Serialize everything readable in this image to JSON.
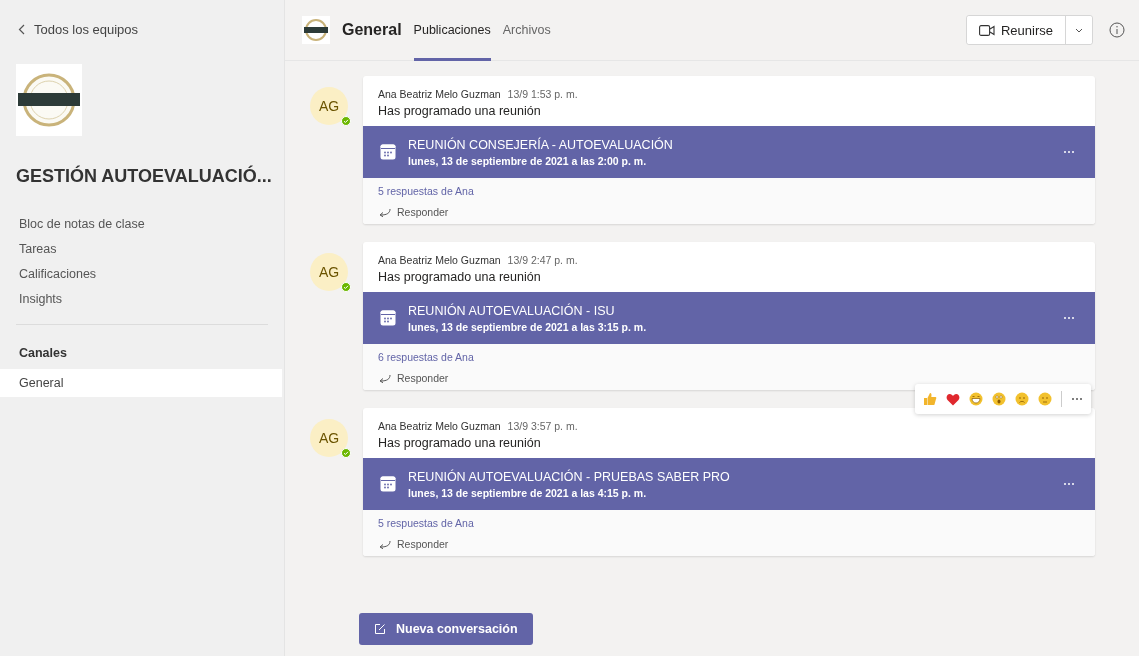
{
  "sidebar": {
    "back_link": "Todos los equipos",
    "team_name": "GESTIÓN AUTOEVALUACIÓ...",
    "items": [
      {
        "label": "Bloc de notas de clase"
      },
      {
        "label": "Tareas"
      },
      {
        "label": "Calificaciones"
      },
      {
        "label": "Insights"
      }
    ],
    "channels_heading": "Canales",
    "channels": [
      {
        "label": "General",
        "selected": true
      }
    ]
  },
  "header": {
    "channel": "General",
    "tabs": [
      {
        "label": "Publicaciones",
        "selected": true
      },
      {
        "label": "Archivos",
        "selected": false
      }
    ],
    "meet_button": "Reunirse"
  },
  "messages": [
    {
      "avatar": "AG",
      "author": "Ana Beatriz Melo Guzman",
      "time": "13/9 1:53 p. m.",
      "text": "Has programado una reunión",
      "meeting_title": "REUNIÓN CONSEJERÍA - AUTOEVALUACIÓN",
      "meeting_date": "lunes, 13 de septiembre de 2021 a las 2:00 p. m.",
      "replies": "5 respuestas de Ana",
      "reply_label": "Responder",
      "reactions_shown": false
    },
    {
      "avatar": "AG",
      "author": "Ana Beatriz Melo Guzman",
      "time": "13/9 2:47 p. m.",
      "text": "Has programado una reunión",
      "meeting_title": "REUNIÓN AUTOEVALUACIÓN - ISU",
      "meeting_date": "lunes, 13 de septiembre de 2021 a las 3:15 p. m.",
      "replies": "6 respuestas de Ana",
      "reply_label": "Responder",
      "reactions_shown": true
    },
    {
      "avatar": "AG",
      "author": "Ana Beatriz Melo Guzman",
      "time": "13/9 3:57 p. m.",
      "text": "Has programado una reunión",
      "meeting_title": "REUNIÓN AUTOEVALUACIÓN - PRUEBAS SABER PRO",
      "meeting_date": "lunes, 13 de septiembre de 2021 a las 4:15 p. m.",
      "replies": "5 respuestas de Ana",
      "reply_label": "Responder",
      "reactions_shown": false
    }
  ],
  "compose_button": "Nueva conversación"
}
